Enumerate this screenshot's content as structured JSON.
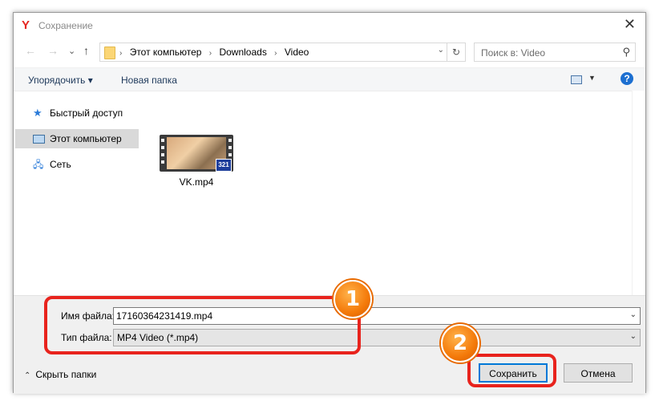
{
  "window": {
    "title": "Сохранение",
    "logo": "Y",
    "close_glyph": "✕"
  },
  "navigation": {
    "back_glyph": "←",
    "forward_glyph": "→",
    "recent_glyph": "⌄",
    "up_glyph": "↑"
  },
  "address_bar": {
    "crumbs": [
      "Этот компьютер",
      "Downloads",
      "Video"
    ],
    "separator": "›",
    "dropdown_glyph": "⌄",
    "refresh_glyph": "↻"
  },
  "search": {
    "placeholder": "Поиск в: Video",
    "icon_glyph": "⚲"
  },
  "toolbar": {
    "organize_label": "Упорядочить ▾",
    "new_folder_label": "Новая папка",
    "view_dropdown_glyph": "▼",
    "help_glyph": "?"
  },
  "sidebar": {
    "items": [
      {
        "label": "Быстрый доступ",
        "icon": "star-icon",
        "glyph": "★"
      },
      {
        "label": "Этот компьютер",
        "icon": "computer-icon",
        "glyph": ""
      },
      {
        "label": "Сеть",
        "icon": "network-icon",
        "glyph": "🖧"
      }
    ]
  },
  "files": [
    {
      "name": "VK.mp4",
      "type": "video",
      "badge": "321"
    }
  ],
  "form": {
    "filename_label": "Имя файла:",
    "filename_value": "17160364231419.mp4",
    "filetype_label": "Тип файла:",
    "filetype_value": "MP4 Video (*.mp4)",
    "dropdown_glyph": "⌄"
  },
  "footer": {
    "hide_folders_label": "Скрыть папки",
    "hide_folders_glyph": "⌃",
    "save_label": "Сохранить",
    "cancel_label": "Отмена"
  },
  "annotations": {
    "marker_1": "1",
    "marker_2": "2",
    "color": "#e8231d",
    "marker_color": "#f47a0a"
  }
}
